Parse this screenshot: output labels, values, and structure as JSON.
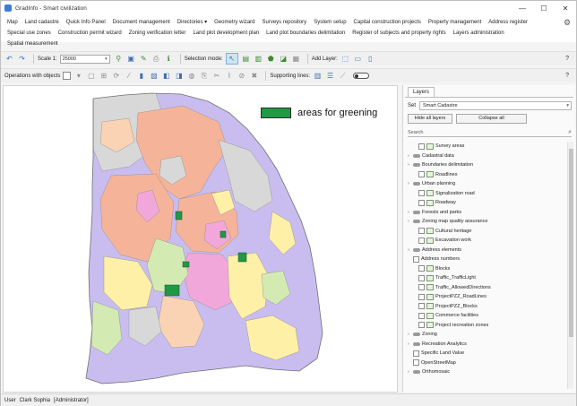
{
  "window": {
    "title": "GradInfo - Smart civilization",
    "minimize": "—",
    "maximize": "☐",
    "close": "✕"
  },
  "menu": {
    "row1": [
      "Map",
      "Land cadastre",
      "Quick Info Panel",
      "Document management",
      "Directories ▾",
      "Geometry wizard",
      "Surveys repository",
      "System setup",
      "Capital construction projects",
      "Property management",
      "Address register"
    ],
    "row2": [
      "Special use zones",
      "Construction permit wizard",
      "Zoning verification letter",
      "Land plot development plan",
      "Land plot boundaries delimitation",
      "Register of subjects and property rights",
      "Layers administration"
    ],
    "row3": [
      "Spatial measurement"
    ]
  },
  "toolbar1": {
    "scale_label": "Scale 1:",
    "scale_value": "25000",
    "selection_mode_label": "Selection mode:",
    "add_layer_label": "Add Layer:",
    "help": "?"
  },
  "toolbar2": {
    "operations_label": "Operations with objects",
    "supporting_lines_label": "Supporting lines:",
    "help": "?"
  },
  "map": {
    "legend_label": "areas for greening",
    "legend_color": "#1e9a45",
    "colors": {
      "orange": "#f5b49a",
      "violet": "#c9bdf0",
      "yellow": "#fff0a8",
      "pink": "#f2a7da",
      "lightgreen": "#d3ebb3",
      "gray": "#d8d8d8",
      "peach": "#fad3b5",
      "green": "#1e9a45"
    }
  },
  "layers_panel": {
    "tab": "Layers",
    "set_label": "Set",
    "set_value": "Smart Cadastre",
    "hide_all": "Hide all layers",
    "collapse_all": "Collapse all",
    "search_placeholder": "Search",
    "items": [
      {
        "label": "Survey areas",
        "level": 1,
        "expand": false,
        "checkbox": true,
        "icon": "layer"
      },
      {
        "label": "Cadastral data",
        "level": 0,
        "expand": true,
        "checkbox": false,
        "icon": "group"
      },
      {
        "label": "Boundaries delimitation",
        "level": 0,
        "expand": true,
        "checkbox": false,
        "icon": "group"
      },
      {
        "label": "Roadlines",
        "level": 1,
        "expand": false,
        "checkbox": true,
        "icon": "layer"
      },
      {
        "label": "Urban planning",
        "level": 0,
        "expand": true,
        "checkbox": false,
        "icon": "group"
      },
      {
        "label": "Signalization road",
        "level": 1,
        "expand": false,
        "checkbox": true,
        "icon": "layer"
      },
      {
        "label": "Roadway",
        "level": 1,
        "expand": false,
        "checkbox": true,
        "icon": "layer"
      },
      {
        "label": "Forests and parks",
        "level": 0,
        "expand": true,
        "checkbox": false,
        "icon": "group"
      },
      {
        "label": "Zoning map quality assurance",
        "level": 0,
        "expand": true,
        "checkbox": false,
        "icon": "group"
      },
      {
        "label": "Cultural heritage",
        "level": 1,
        "expand": false,
        "checkbox": true,
        "icon": "layer"
      },
      {
        "label": "Excavation work",
        "level": 1,
        "expand": false,
        "checkbox": true,
        "icon": "layer"
      },
      {
        "label": "Address elements",
        "level": 0,
        "expand": true,
        "checkbox": false,
        "icon": "group"
      },
      {
        "label": "Address numbers",
        "level": 0,
        "expand": false,
        "checkbox": true,
        "icon": "none"
      },
      {
        "label": "Blocks",
        "level": 1,
        "expand": false,
        "checkbox": true,
        "icon": "layer"
      },
      {
        "label": "Traffic_TrafficLight",
        "level": 1,
        "expand": false,
        "checkbox": true,
        "icon": "layer"
      },
      {
        "label": "Traffic_AllowedDirections",
        "level": 1,
        "expand": false,
        "checkbox": true,
        "icon": "layer"
      },
      {
        "label": "ProjectPZZ_RoadLines",
        "level": 1,
        "expand": false,
        "checkbox": true,
        "icon": "layer"
      },
      {
        "label": "ProjectPZZ_Blocks",
        "level": 1,
        "expand": false,
        "checkbox": true,
        "icon": "layer"
      },
      {
        "label": "Commerce facilities",
        "level": 1,
        "expand": false,
        "checkbox": true,
        "icon": "layer"
      },
      {
        "label": "Project recreation zones",
        "level": 1,
        "expand": false,
        "checkbox": true,
        "icon": "layer"
      },
      {
        "label": "Zoning",
        "level": 0,
        "expand": true,
        "checkbox": false,
        "icon": "group"
      },
      {
        "label": "Recreation Analytics",
        "level": 0,
        "expand": true,
        "checkbox": false,
        "icon": "group"
      },
      {
        "label": "Specific Land Value",
        "level": 0,
        "expand": false,
        "checkbox": true,
        "icon": "none"
      },
      {
        "label": "OpenStreetMap",
        "level": 0,
        "expand": false,
        "checkbox": true,
        "icon": "none"
      },
      {
        "label": "Orthomosaic",
        "level": 0,
        "expand": true,
        "checkbox": false,
        "icon": "group"
      }
    ]
  },
  "status": {
    "user_label": "User",
    "user_name": "Clark Sophia",
    "role": "[Administrator]"
  }
}
